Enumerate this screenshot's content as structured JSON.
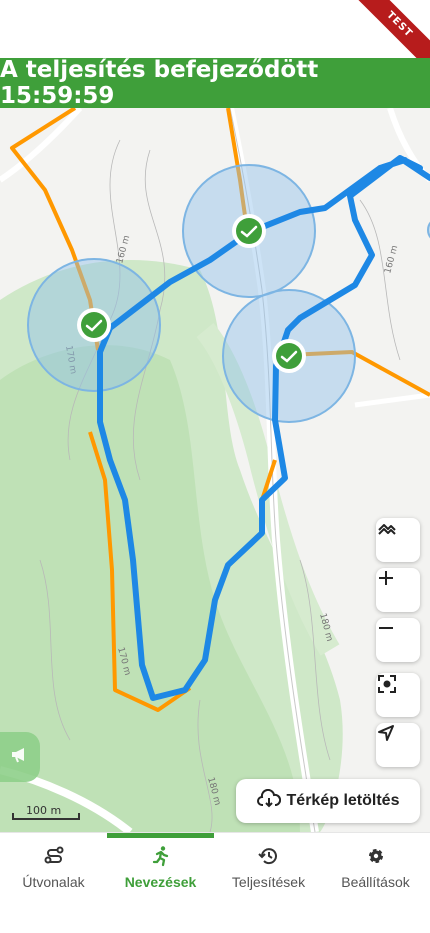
{
  "banner": {
    "title": "A teljesítés befejeződött 15:59:59",
    "color": "#3f9f3a"
  },
  "badge": {
    "label": "TEST"
  },
  "map": {
    "contour_labels": [
      "160 m",
      "170 m",
      "160 m",
      "180 m",
      "180 m",
      "170 m"
    ],
    "scale_label": "100 m",
    "route_color": "#1e88e5",
    "trail_color": "#ff9800",
    "checkpoint_color": "#3f9f3a"
  },
  "map_controls": {
    "layers_icon": "layers-icon",
    "zoom_in_icon": "plus-icon",
    "zoom_out_icon": "minus-icon",
    "center_icon": "focus-icon",
    "locate_icon": "navigation-icon"
  },
  "download": {
    "label": "Térkép letöltés"
  },
  "nav": {
    "items": [
      {
        "label": "Útvonalak",
        "icon": "route-icon"
      },
      {
        "label": "Nevezések",
        "icon": "runner-icon"
      },
      {
        "label": "Teljesítések",
        "icon": "history-icon"
      },
      {
        "label": "Beállítások",
        "icon": "gear-icon"
      }
    ],
    "active_index": 1
  }
}
